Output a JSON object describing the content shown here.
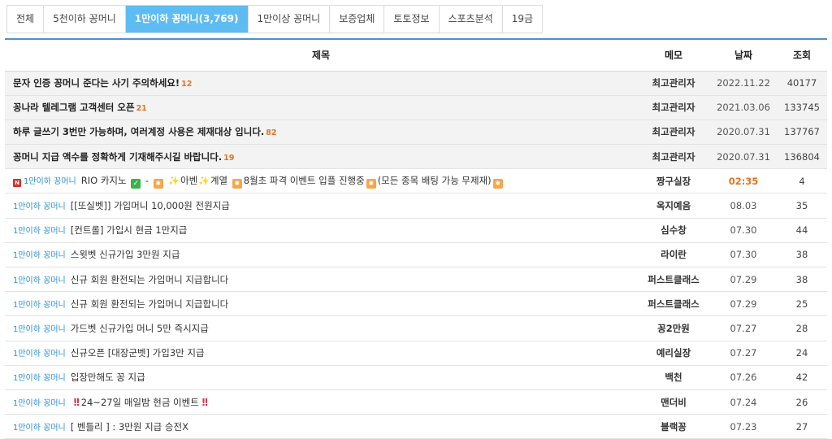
{
  "tabs": [
    {
      "label": "전체",
      "active": false
    },
    {
      "label": "5천이하 꽁머니",
      "active": false
    },
    {
      "label": "1만이하 꽁머니(3,769)",
      "active": true
    },
    {
      "label": "1만이상 꽁머니",
      "active": false
    },
    {
      "label": "보증업체",
      "active": false
    },
    {
      "label": "토토정보",
      "active": false
    },
    {
      "label": "스포츠분석",
      "active": false
    },
    {
      "label": "19금",
      "active": false
    }
  ],
  "table": {
    "headers": {
      "title": "제목",
      "memo": "메모",
      "date": "날짜",
      "views": "조회"
    },
    "notices": [
      {
        "title": "문자 인증 꽁머니 준다는 사기 주의하세요!",
        "comments": "12",
        "memo": "최고관리자",
        "date": "2022.11.22",
        "views": "40177"
      },
      {
        "title": "꽁나라 텔레그램 고객센터 오픈",
        "comments": "21",
        "memo": "최고관리자",
        "date": "2021.03.06",
        "views": "133745"
      },
      {
        "title": "하루 글쓰기 3번만 가능하며, 여러계정 사용은 제재대상 입니다.",
        "comments": "82",
        "memo": "최고관리자",
        "date": "2020.07.31",
        "views": "137767"
      },
      {
        "title": "꽁머니 지급 액수를 정확하게 기재해주시길 바랍니다.",
        "comments": "19",
        "memo": "최고관리자",
        "date": "2020.07.31",
        "views": "136804"
      }
    ],
    "featured": {
      "category": "1만이하 꽁머니",
      "seg1": "RIO 카지노",
      "seg2": "-",
      "seg3": "아벤",
      "seg4": "계열",
      "seg5": "8월초 파격 이벤트 입플 진행중",
      "seg6": "(모든 종목 배팅 가능 무제재)",
      "memo": "짱구실장",
      "date": "02:35",
      "views": "4"
    },
    "rows": [
      {
        "category": "1만이하 꽁머니",
        "title": "[[또실벳]] 가입머니 10,000원 전원지급",
        "memo": "옥지예음",
        "date": "08.03",
        "views": "35"
      },
      {
        "category": "1만이하 꽁머니",
        "title": "[컨트롤] 가입시 현금 1만지급",
        "memo": "심수창",
        "date": "07.30",
        "views": "44"
      },
      {
        "category": "1만이하 꽁머니",
        "title": "스윗벳 신규가입 3만원 지급",
        "memo": "라이란",
        "date": "07.30",
        "views": "38"
      },
      {
        "category": "1만이하 꽁머니",
        "title": "신규 회원 환전되는 가입머니 지급합니다",
        "memo": "퍼스트클래스",
        "date": "07.29",
        "views": "38"
      },
      {
        "category": "1만이하 꽁머니",
        "title": "신규 회원 환전되는 가입머니 지급합니다",
        "memo": "퍼스트클래스",
        "date": "07.29",
        "views": "25"
      },
      {
        "category": "1만이하 꽁머니",
        "title": "가드벳 신규가입 머니 5만 즉시지급",
        "memo": "꽁2만원",
        "date": "07.27",
        "views": "28"
      },
      {
        "category": "1만이하 꽁머니",
        "title": "신규오픈 [대장군벳] 가입3만 지급",
        "memo": "예리실장",
        "date": "07.27",
        "views": "24"
      },
      {
        "category": "1만이하 꽁머니",
        "title": "입장만해도 꽁 지급",
        "memo": "백천",
        "date": "07.26",
        "views": "42"
      },
      {
        "category": "1만이하 꽁머니",
        "title": "24~27일 매일밤 현금 이벤트",
        "memo": "맨더비",
        "date": "07.24",
        "views": "26"
      },
      {
        "category": "1만이하 꽁머니",
        "title": "[ 벤틀리 ] : 3만원 지급 승전X",
        "memo": "블랙꽁",
        "date": "07.23",
        "views": "27"
      }
    ]
  },
  "colors": {
    "accent": "#5dbcf2",
    "header_line": "#4a90d6",
    "comment": "#e8711d",
    "category": "#2a8fcf"
  }
}
